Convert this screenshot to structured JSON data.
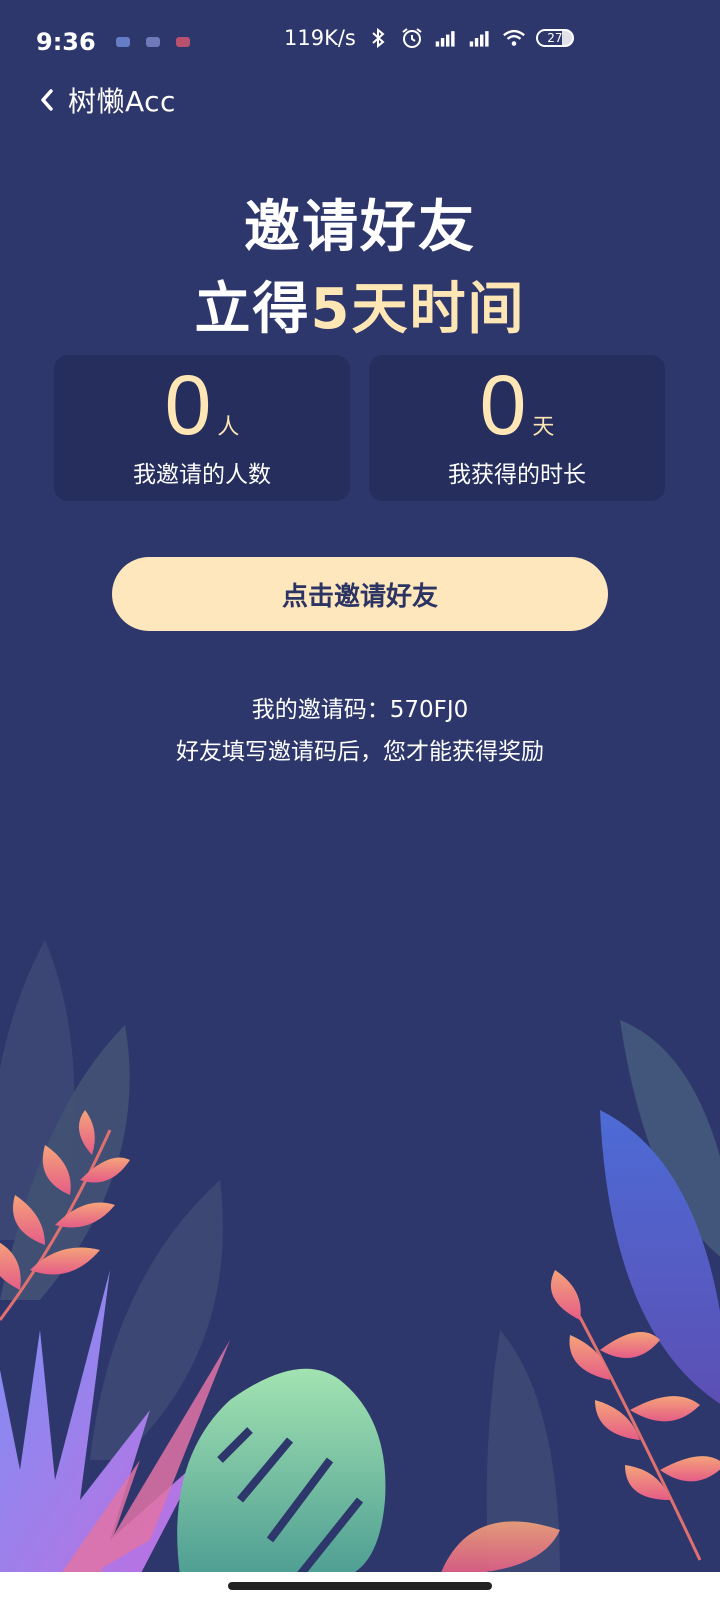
{
  "status_bar": {
    "time": "9:36",
    "net_speed": "119K/s",
    "battery": "27"
  },
  "nav": {
    "title": "树懒Acc"
  },
  "headline": {
    "line1": "邀请好友",
    "line2_prefix": "立得",
    "line2_highlight": "5天时间"
  },
  "stats": [
    {
      "value": "0",
      "unit": "人",
      "label": "我邀请的人数"
    },
    {
      "value": "0",
      "unit": "天",
      "label": "我获得的时长"
    }
  ],
  "invite_button": {
    "label": "点击邀请好友"
  },
  "invite_info": {
    "code_line": "我的邀请码：570FJ0",
    "tip": "好友填写邀请码后，您才能获得奖励"
  },
  "colors": {
    "background": "#2e376b",
    "card": "#262e5e",
    "accent": "#ffe6b5",
    "button": "#ffe7bd",
    "button_text": "#2b3463"
  },
  "icons": {
    "back": "chevron-left-icon",
    "bluetooth": "bluetooth-icon",
    "alarm": "alarm-icon",
    "signal": "signal-icon",
    "wifi": "wifi-icon"
  }
}
